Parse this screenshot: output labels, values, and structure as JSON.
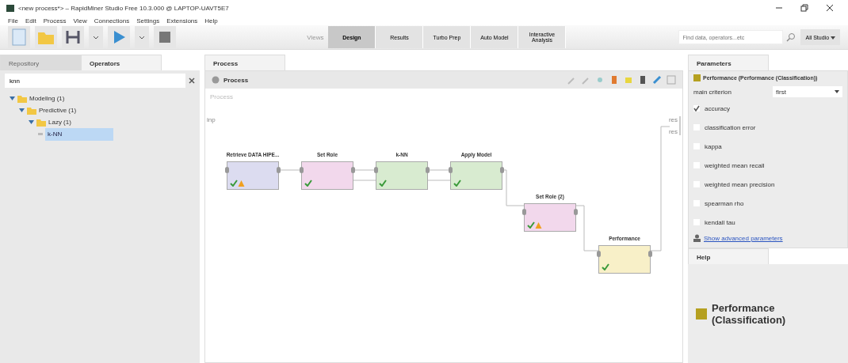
{
  "window": {
    "title": "<new process*> – RapidMiner Studio Free 10.3.000 @ LAPTOP-UAVT5E7"
  },
  "menu": [
    "File",
    "Edit",
    "Process",
    "View",
    "Connections",
    "Settings",
    "Extensions",
    "Help"
  ],
  "views": {
    "label": "Views",
    "items": [
      {
        "label": "Design",
        "selected": true
      },
      {
        "label": "Results",
        "selected": false
      },
      {
        "label": "Turbo Prep",
        "selected": false
      },
      {
        "label": "Auto Model",
        "selected": false
      },
      {
        "label": "Interactive Analysis",
        "selected": false
      }
    ]
  },
  "global_search": {
    "placeholder": "Find data, operators...etc",
    "scope": "All Studio"
  },
  "left_panel": {
    "tabs": [
      {
        "label": "Repository",
        "selected": false
      },
      {
        "label": "Operators",
        "selected": true
      }
    ],
    "search": {
      "value": "knn"
    },
    "tree": [
      {
        "label": "Modeling (1)",
        "expanded": true,
        "selected": false,
        "children": [
          {
            "label": "Predictive (1)",
            "expanded": true,
            "selected": false,
            "children": [
              {
                "label": "Lazy (1)",
                "expanded": true,
                "selected": false,
                "children": [
                  {
                    "label": "k-NN",
                    "selected": true
                  }
                ]
              }
            ]
          }
        ]
      }
    ]
  },
  "process": {
    "tab": "Process",
    "breadcrumb": "Process",
    "canvas_label": "Process",
    "input_port": "inp",
    "output_ports": [
      "res",
      "res"
    ],
    "operators": [
      {
        "name": "Retrieve DATA HIPE...",
        "color": "#dcdcf0",
        "warning": true
      },
      {
        "name": "Set Role",
        "color": "#f2d8ec",
        "warning": false
      },
      {
        "name": "k-NN",
        "color": "#d8ebd0",
        "warning": false
      },
      {
        "name": "Apply Model",
        "color": "#d8ebd0",
        "warning": false
      },
      {
        "name": "Set Role (2)",
        "color": "#f2d8ec",
        "warning": true
      },
      {
        "name": "Performance",
        "color": "#f8f0c8",
        "warning": false
      }
    ]
  },
  "parameters": {
    "tab": "Parameters",
    "operator": "Performance (Performance (Classification))",
    "main_criterion": {
      "label": "main criterion",
      "value": "first"
    },
    "criteria": [
      {
        "label": "accuracy",
        "checked": true
      },
      {
        "label": "classification error",
        "checked": false
      },
      {
        "label": "kappa",
        "checked": false
      },
      {
        "label": "weighted mean recall",
        "checked": false
      },
      {
        "label": "weighted mean precision",
        "checked": false
      },
      {
        "label": "spearman rho",
        "checked": false
      },
      {
        "label": "kendall tau",
        "checked": false
      }
    ],
    "advanced_link": "Show advanced parameters"
  },
  "help": {
    "tab": "Help",
    "title": "Performance (Classification)"
  }
}
